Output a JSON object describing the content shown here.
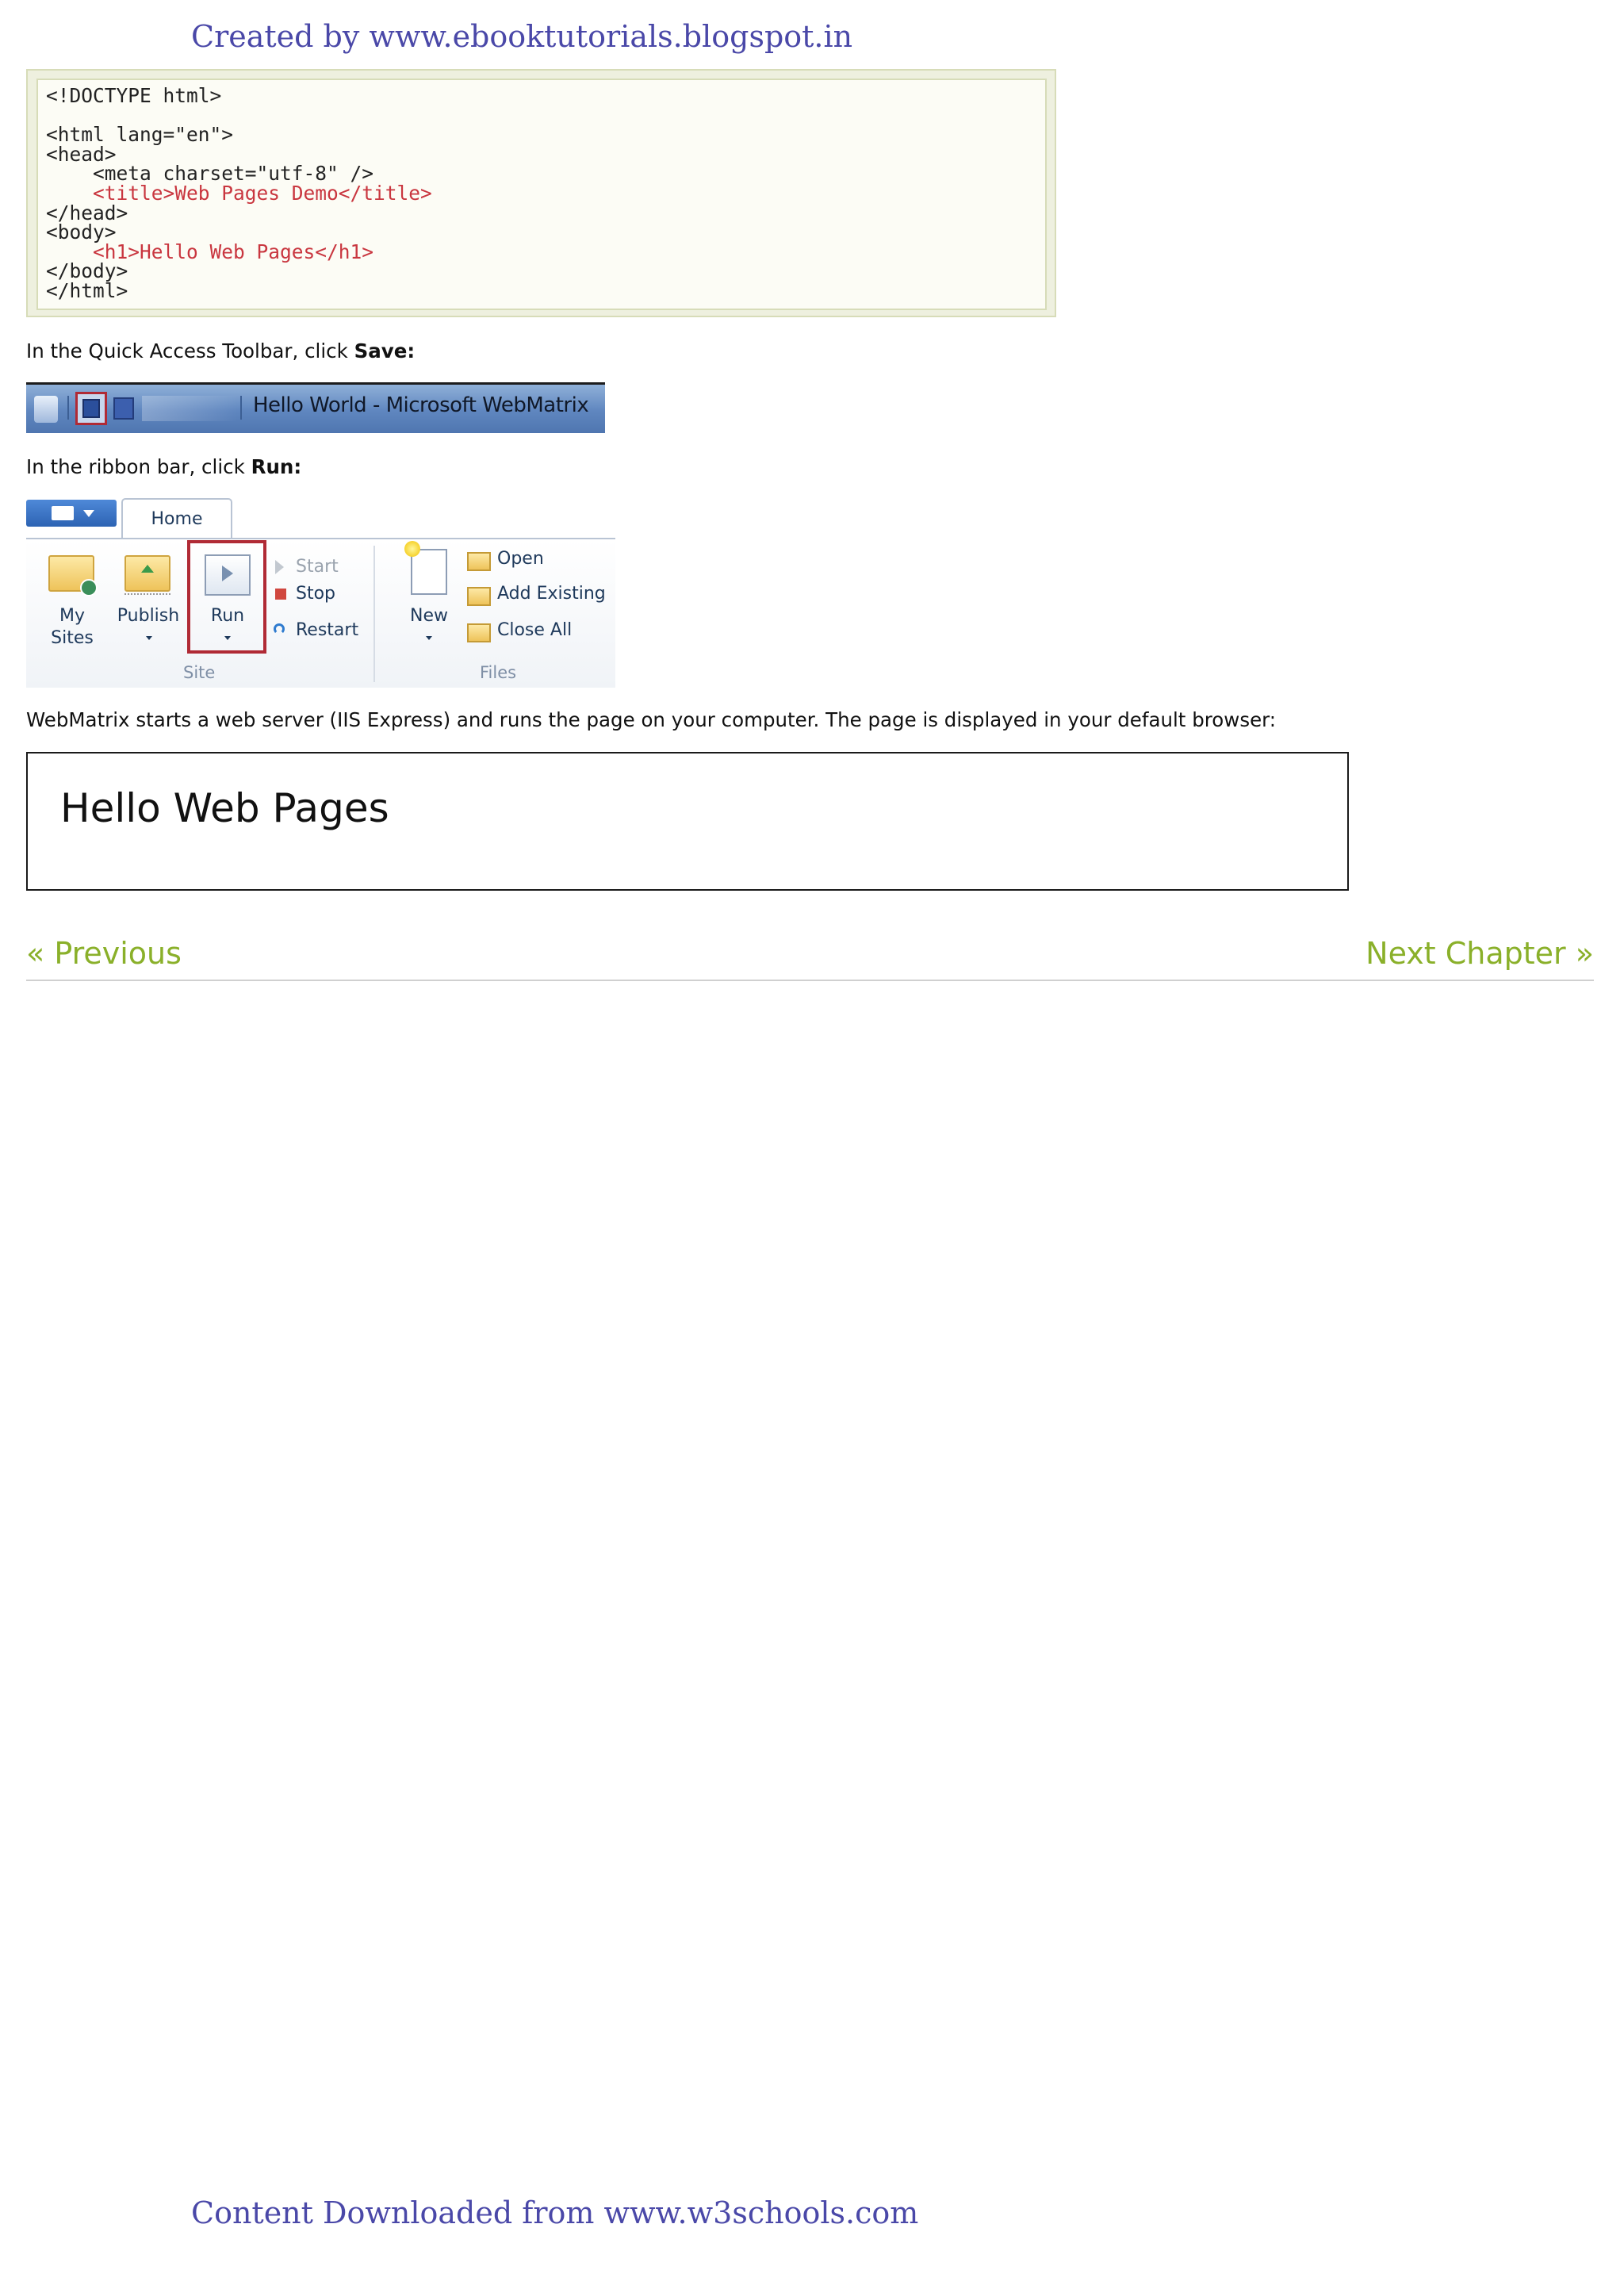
{
  "header_text": "Created by www.ebooktutorials.blogspot.in",
  "footer_text": "Content Downloaded from www.w3schools.com",
  "code_lines": [
    {
      "text": "<!DOCTYPE html>",
      "red": false
    },
    {
      "text": "",
      "red": false
    },
    {
      "text": "<html lang=\"en\">",
      "red": false
    },
    {
      "text": "<head>",
      "red": false
    },
    {
      "text": "    <meta charset=\"utf-8\" />",
      "red": false
    },
    {
      "text": "    <title>Web Pages Demo</title>",
      "red": true
    },
    {
      "text": "</head>",
      "red": false
    },
    {
      "text": "<body>",
      "red": false
    },
    {
      "text": "    <h1>Hello Web Pages</h1>",
      "red": true
    },
    {
      "text": "</body>",
      "red": false
    },
    {
      "text": "</html>",
      "red": false
    }
  ],
  "instructions": {
    "save": {
      "prefix": "In the Quick Access Toolbar, click ",
      "bold": "Save:"
    },
    "run": {
      "prefix": "In the ribbon bar, click ",
      "bold": "Run:"
    },
    "result": "WebMatrix starts a web server (IIS Express) and runs the page on your computer. The page is displayed in your default browser:"
  },
  "titlebar": {
    "title": "Hello World - Microsoft WebMatrix"
  },
  "ribbon": {
    "tab": "Home",
    "my_sites_line1": "My",
    "my_sites_line2": "Sites",
    "publish": "Publish",
    "run": "Run",
    "start": "Start",
    "stop": "Stop",
    "restart": "Restart",
    "new": "New",
    "open": "Open",
    "add_existing": "Add Existing",
    "close_all": "Close All",
    "group_site": "Site",
    "group_files": "Files"
  },
  "browser": {
    "heading": "Hello Web Pages"
  },
  "nav": {
    "previous": "« Previous",
    "next": "Next Chapter »"
  }
}
